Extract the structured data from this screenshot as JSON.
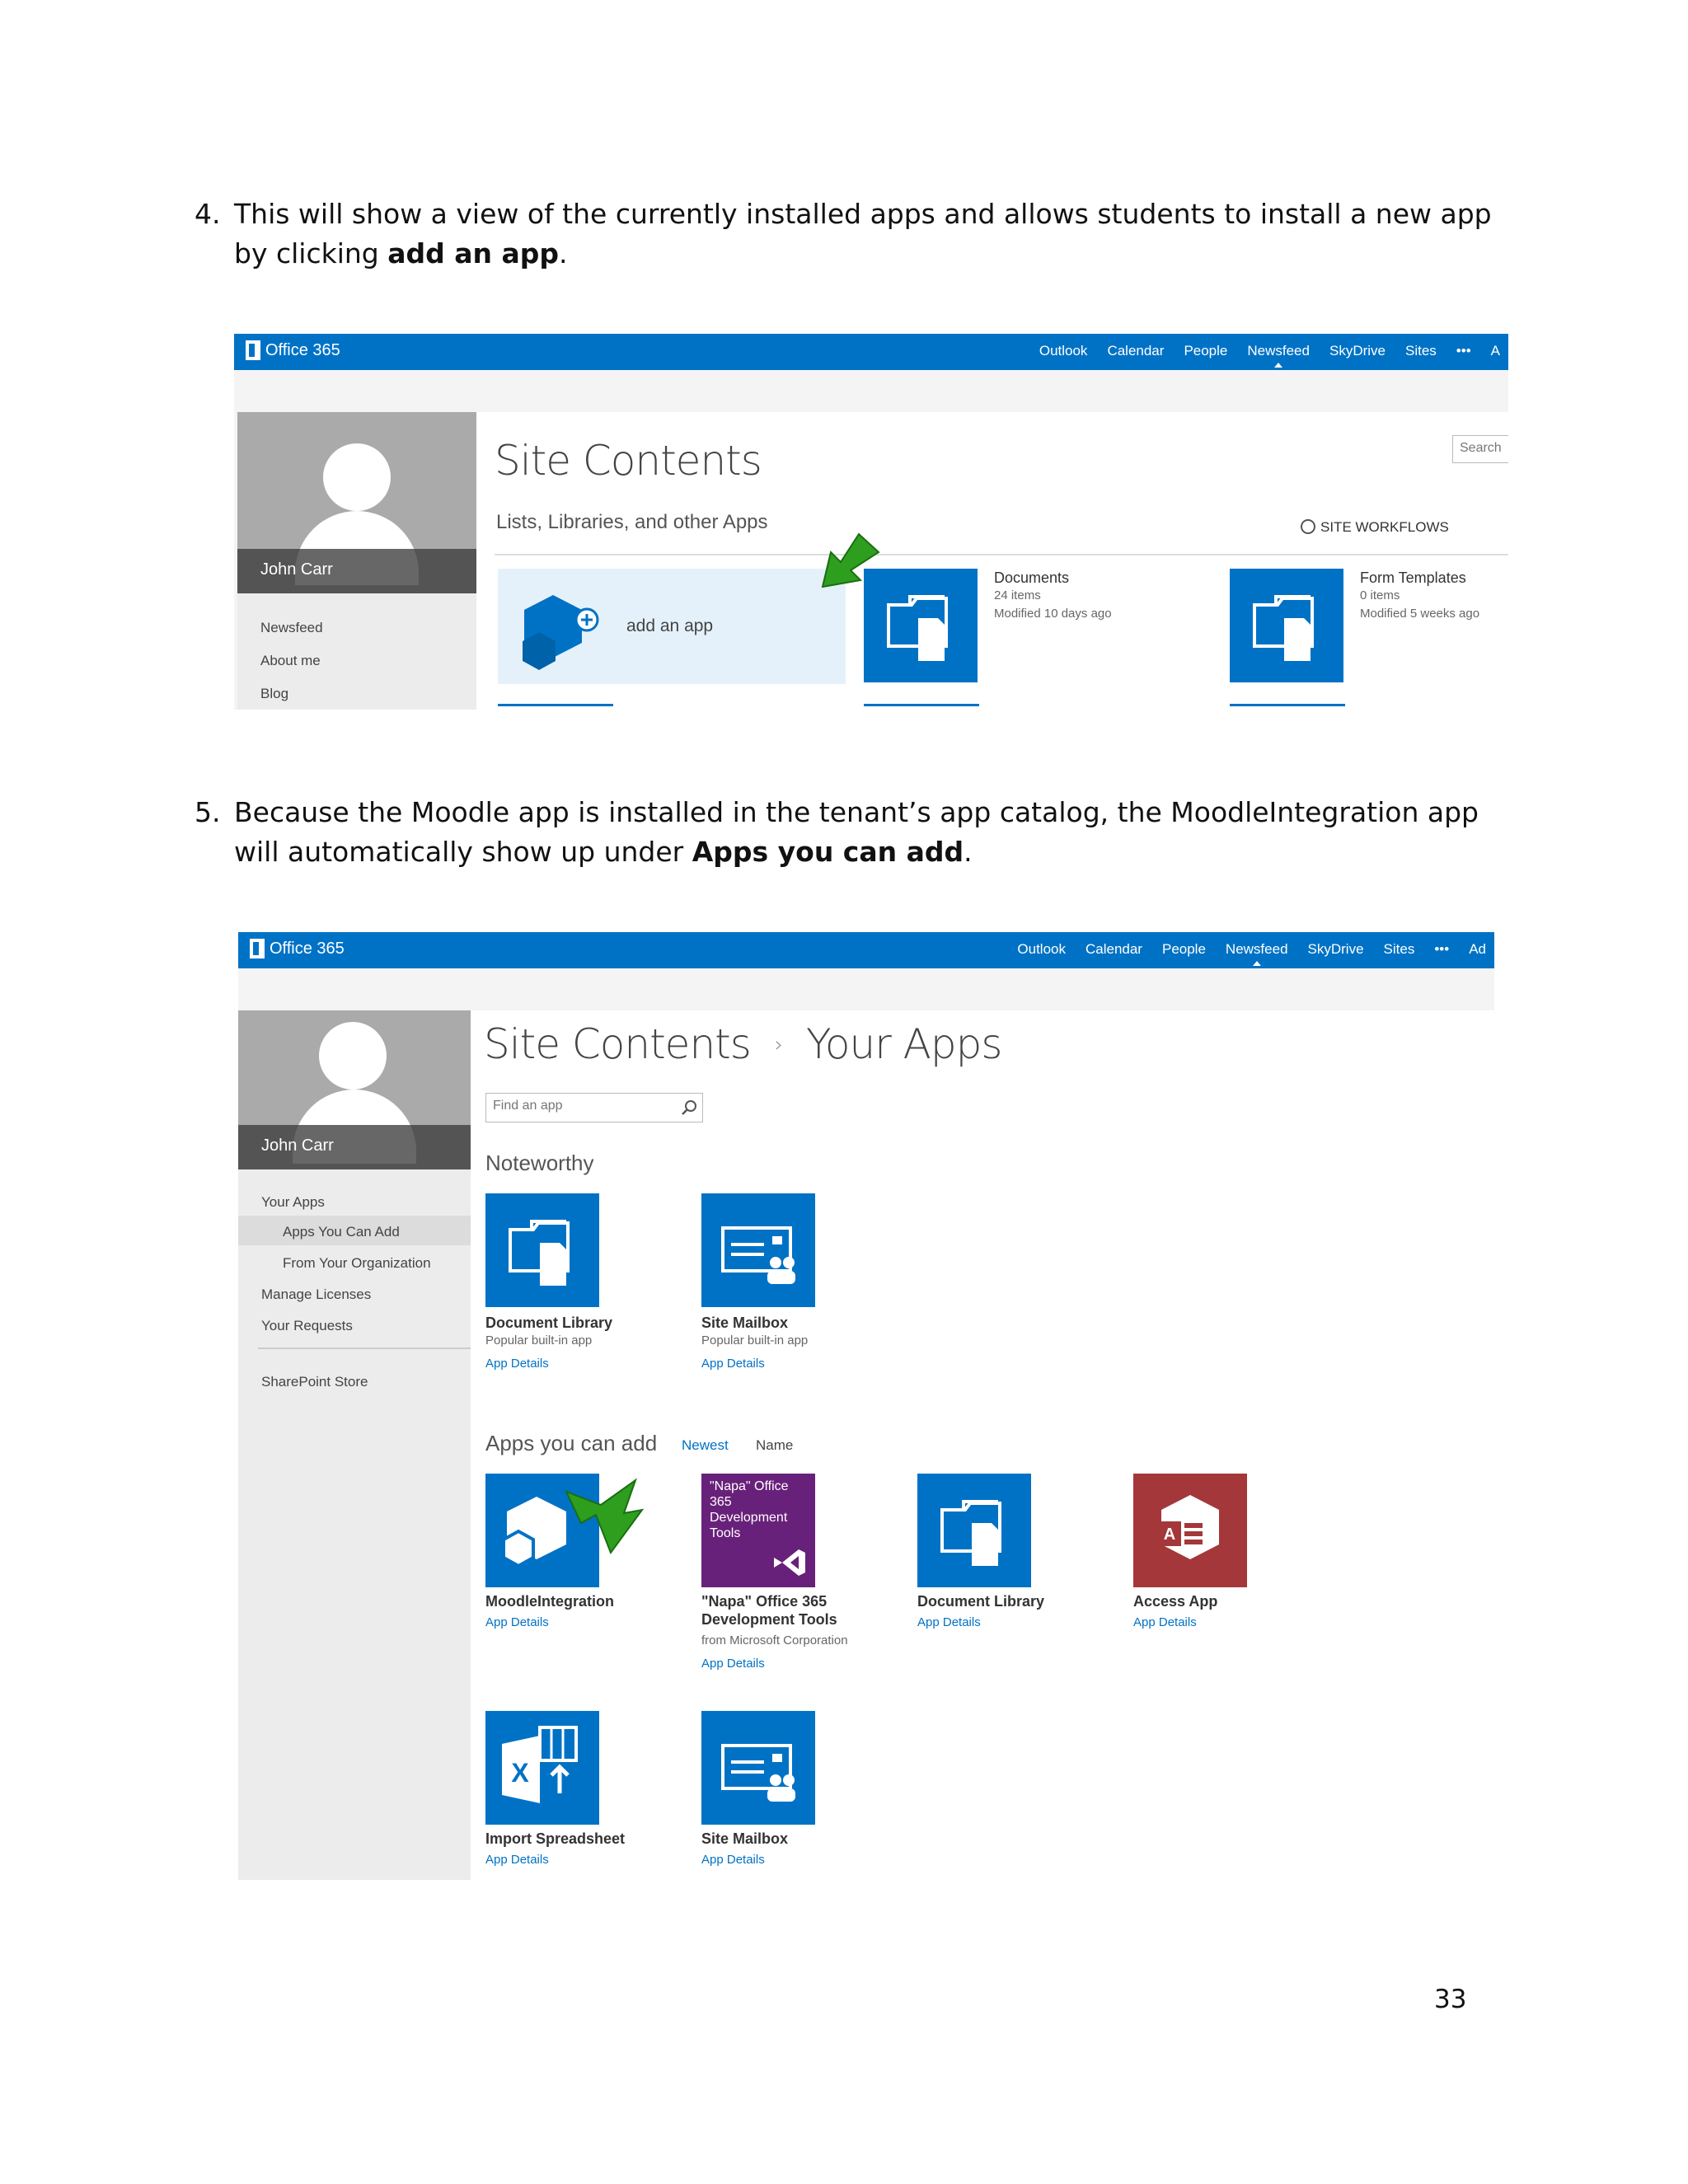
{
  "step4": {
    "number": "4.",
    "text_before": "This will show a view of the currently installed apps and allows students to install a new app by clicking ",
    "bold": "add an app",
    "text_after": "."
  },
  "step5": {
    "number": "5.",
    "text_before": "Because the Moodle app is installed in the tenant’s app catalog, the MoodleIntegration app will automatically show up under ",
    "bold": "Apps you can add",
    "text_after": "."
  },
  "suite": {
    "brand": "Office 365",
    "links1": [
      "Outlook",
      "Calendar",
      "People",
      "Newsfeed",
      "SkyDrive",
      "Sites",
      "•••",
      "A"
    ],
    "links2": [
      "Outlook",
      "Calendar",
      "People",
      "Newsfeed",
      "SkyDrive",
      "Sites",
      "•••",
      "Ad"
    ]
  },
  "profile": {
    "name": "John Carr"
  },
  "shot1": {
    "title": "Site Contents",
    "subtitle": "Lists, Libraries, and other Apps",
    "search": "Search",
    "workflows": "SITE WORKFLOWS",
    "nav": [
      "Newsfeed",
      "About me",
      "Blog"
    ],
    "add_app": "add an app",
    "documents": {
      "name": "Documents",
      "items": "24 items",
      "modified": "Modified 10 days ago"
    },
    "form_templates": {
      "name": "Form Templates",
      "items": "0 items",
      "modified": "Modified 5 weeks ago"
    }
  },
  "shot2": {
    "title": "Site Contents",
    "title_sep": "›",
    "title2": "Your Apps",
    "find_placeholder": "Find an app",
    "noteworthy": "Noteworthy",
    "nav": [
      "Your Apps",
      "Apps You Can Add",
      "From Your Organization",
      "Manage Licenses",
      "Your Requests",
      "SharePoint Store"
    ],
    "noteworthy_apps": [
      {
        "name": "Document Library",
        "sub": "Popular built-in app",
        "link": "App Details"
      },
      {
        "name": "Site Mailbox",
        "sub": "Popular built-in app",
        "link": "App Details"
      }
    ],
    "apps_you_can_add": "Apps you can add",
    "sort_newest": "Newest",
    "sort_name": "Name",
    "napa_tile_text": "\"Napa\" Office 365 Development Tools",
    "apps": [
      {
        "name": "MoodleIntegration",
        "link": "App Details"
      },
      {
        "name": "\"Napa\" Office 365",
        "name2": "Development Tools",
        "sub": "from Microsoft Corporation",
        "link": "App Details"
      },
      {
        "name": "Document Library",
        "link": "App Details"
      },
      {
        "name": "Access App",
        "link": "App Details"
      },
      {
        "name": "Import Spreadsheet",
        "link": "App Details"
      },
      {
        "name": "Site Mailbox",
        "link": "App Details"
      }
    ]
  },
  "page_number": "33",
  "colors": {
    "suite_blue": "#0072c6",
    "napa_purple": "#68217a",
    "access_red": "#a4373a",
    "arrow_green": "#2e9e1f"
  },
  "icons": [
    "office-logo-icon",
    "person-icon",
    "folder-doc-icon",
    "mailbox-icon",
    "hexagon-add-icon",
    "visual-studio-icon",
    "access-icon",
    "excel-import-icon",
    "search-icon",
    "workflow-check-icon",
    "green-arrow-icon"
  ]
}
